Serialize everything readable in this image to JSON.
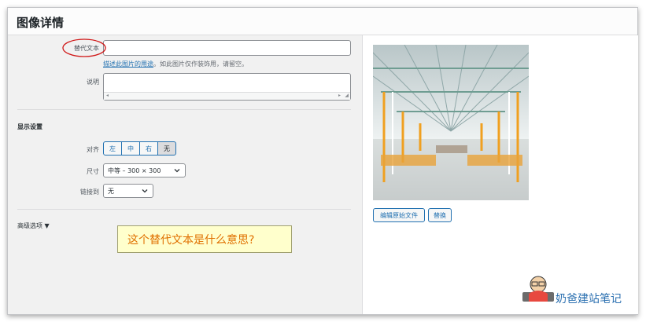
{
  "header": {
    "title": "图像详情"
  },
  "alt": {
    "label": "替代文本",
    "value": "",
    "help_link": "描述此图片的用途",
    "help_text": "。如此图片仅作装饰用，请留空。"
  },
  "caption": {
    "label": "说明",
    "value": ""
  },
  "display": {
    "section_title": "显示设置",
    "align_label": "对齐",
    "align_options": [
      "左",
      "中",
      "右",
      "无"
    ],
    "align_selected": "无",
    "size_label": "尺寸",
    "size_value": "中等 – 300 × 300",
    "link_label": "链接到",
    "link_value": "无"
  },
  "advanced": {
    "label": "高级选项 ▼"
  },
  "annotation": {
    "text": "这个替代文本是什么意思?"
  },
  "image_actions": {
    "edit_original": "编辑原始文件",
    "replace": "替换"
  },
  "watermark": {
    "text": "奶爸建站笔记"
  }
}
